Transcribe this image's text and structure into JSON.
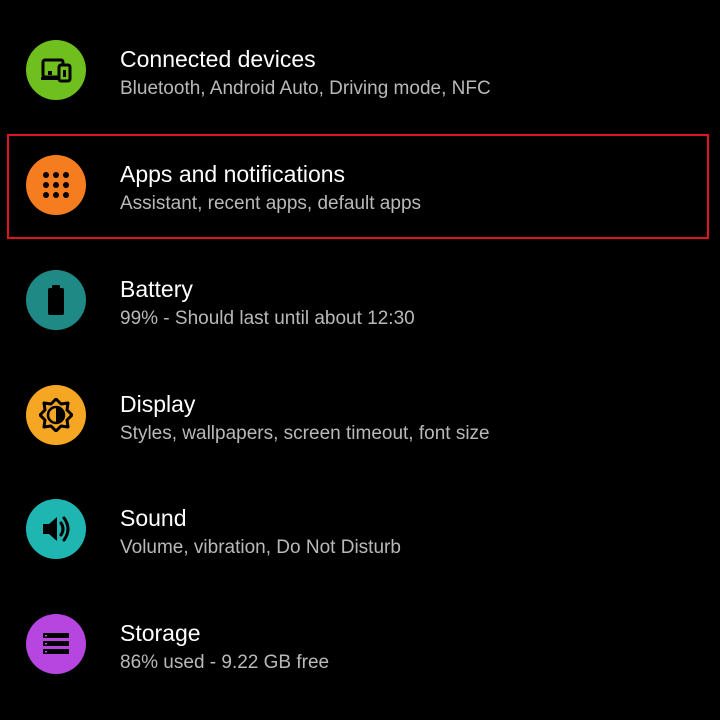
{
  "colors": {
    "background": "#000000",
    "title_text": "#ffffff",
    "subtitle_text": "#b9b9b9",
    "highlight_border": "#e0141f"
  },
  "settings": {
    "items": [
      {
        "title": "Connected devices",
        "subtitle": "Bluetooth, Android Auto, Driving mode, NFC",
        "icon": "connected-devices-icon",
        "icon_color": "#6fbf1f"
      },
      {
        "title": "Apps and notifications",
        "subtitle": "Assistant, recent apps, default apps",
        "icon": "apps-grid-icon",
        "icon_color": "#f57c1f",
        "highlighted": true
      },
      {
        "title": "Battery",
        "subtitle": "99% - Should last until about 12:30",
        "icon": "battery-icon",
        "icon_color": "#1f8a85"
      },
      {
        "title": "Display",
        "subtitle": "Styles, wallpapers, screen timeout, font size",
        "icon": "display-brightness-icon",
        "icon_color": "#f5a623"
      },
      {
        "title": "Sound",
        "subtitle": "Volume, vibration, Do Not Disturb",
        "icon": "sound-volume-icon",
        "icon_color": "#1fb5b0"
      },
      {
        "title": "Storage",
        "subtitle": "86% used - 9.22 GB free",
        "icon": "storage-icon",
        "icon_color": "#b746e0"
      }
    ]
  }
}
